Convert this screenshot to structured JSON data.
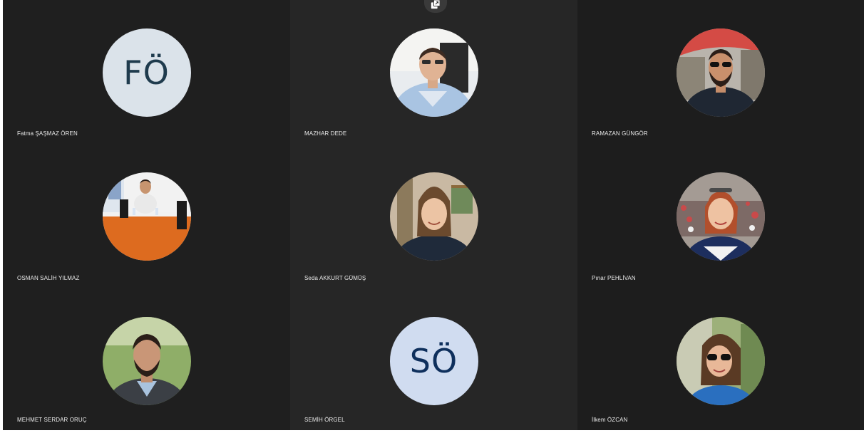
{
  "toolbar": {
    "popout_icon": "popout-icon"
  },
  "participants": [
    {
      "name": "Fatma ŞAŞMAZ ÖREN",
      "initials": "FÖ",
      "avatar_type": "initials",
      "avatar_bg": "#dbe3ea",
      "initials_color": "#1f3b4d"
    },
    {
      "name": "MAZHAR DEDE",
      "avatar_type": "photo",
      "photo": "man-glasses-office"
    },
    {
      "name": "RAMAZAN GÜNGÖR",
      "avatar_type": "photo",
      "photo": "man-sunglasses-outdoor"
    },
    {
      "name": "OSMAN SALİH YILMAZ",
      "avatar_type": "photo",
      "photo": "man-at-orange-table"
    },
    {
      "name": "Seda AKKURT GÜMÜŞ",
      "avatar_type": "photo",
      "photo": "woman-smiling-indoor"
    },
    {
      "name": "Pınar PEHLİVAN",
      "avatar_type": "photo",
      "photo": "woman-red-hair-outdoor"
    },
    {
      "name": "MEHMET SERDAR ORUÇ",
      "avatar_type": "photo",
      "photo": "man-beard-outdoor"
    },
    {
      "name": "SEMİH ÖRGEL",
      "initials": "SÖ",
      "avatar_type": "initials",
      "avatar_bg": "#d0dcf0",
      "initials_color": "#0e2f5c"
    },
    {
      "name": "İlkem ÖZCAN",
      "avatar_type": "photo",
      "photo": "woman-sunglasses-trees"
    }
  ]
}
